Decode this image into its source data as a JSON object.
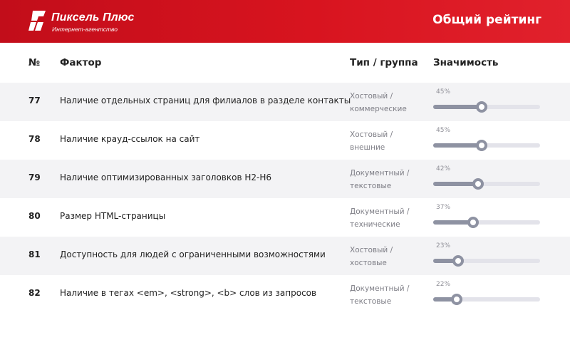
{
  "header": {
    "logo_name": "Пиксель Плюс",
    "logo_tagline": "Интернет-агентство",
    "title": "Общий рейтинг"
  },
  "columns": {
    "num": "№",
    "factor": "Фактор",
    "type": "Тип / группа",
    "significance": "Значимость"
  },
  "rows": [
    {
      "num": "77",
      "factor": "Наличие отдельных страниц для филиалов в разделе контакты",
      "type_line1": "Хостовый /",
      "type_line2": "коммерческие",
      "pct_label": "45%",
      "value": 45
    },
    {
      "num": "78",
      "factor": "Наличие крауд-ссылок на сайт",
      "type_line1": "Хостовый /",
      "type_line2": "внешние",
      "pct_label": "45%",
      "value": 45
    },
    {
      "num": "79",
      "factor": "Наличие оптимизированных заголовков H2-H6",
      "type_line1": "Документный /",
      "type_line2": "текстовые",
      "pct_label": "42%",
      "value": 42
    },
    {
      "num": "80",
      "factor": "Размер HTML-страницы",
      "type_line1": "Документный /",
      "type_line2": "технические",
      "pct_label": "37%",
      "value": 37
    },
    {
      "num": "81",
      "factor": "Доступность для людей с ограниченными возможностями",
      "type_line1": "Хостовый /",
      "type_line2": "хостовые",
      "pct_label": "23%",
      "value": 23
    },
    {
      "num": "82",
      "factor": "Наличие в тегах <em>, <strong>, <b> слов из запросов",
      "type_line1": "Документный /",
      "type_line2": "текстовые",
      "pct_label": "22%",
      "value": 22
    }
  ],
  "colors": {
    "header_red": "#d8141f",
    "bar_fill": "#8e92a2",
    "bar_track": "#e3e3ea",
    "row_shade": "#f3f3f5"
  }
}
